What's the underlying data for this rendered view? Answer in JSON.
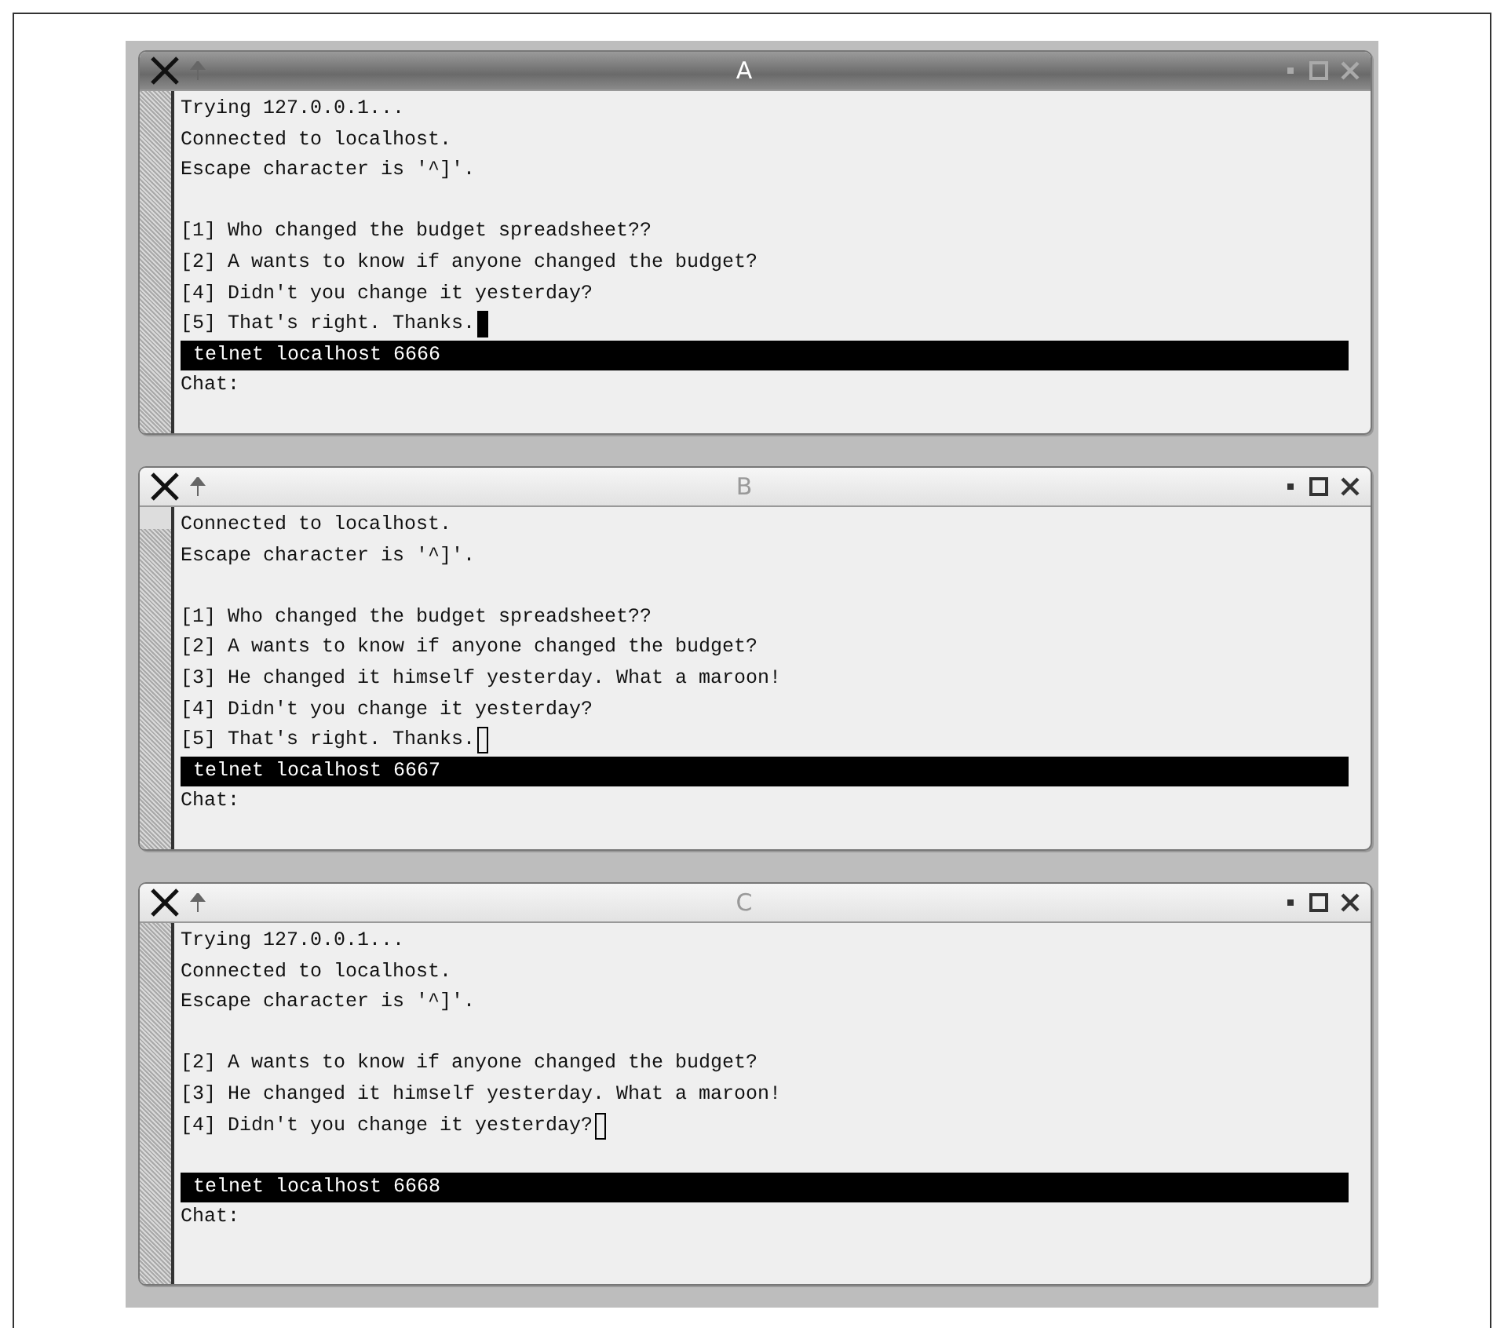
{
  "windows": [
    {
      "title": "A",
      "focused": true,
      "lines": [
        {
          "kind": "text",
          "text": "Trying 127.0.0.1..."
        },
        {
          "kind": "text",
          "text": "Connected to localhost."
        },
        {
          "kind": "text",
          "text": "Escape character is '^]'."
        },
        {
          "kind": "blank"
        },
        {
          "kind": "text",
          "text": "[1] Who changed the budget spreadsheet??"
        },
        {
          "kind": "text",
          "text": "[2] A wants to know if anyone changed the budget?"
        },
        {
          "kind": "text",
          "text": "[4] Didn't you change it yesterday?"
        },
        {
          "kind": "text",
          "text": "[5] That's right. Thanks."
        }
      ],
      "status": "telnet localhost 6666",
      "prompt": "Chat:"
    },
    {
      "title": "B",
      "focused": false,
      "lines": [
        {
          "kind": "text",
          "text": "Connected to localhost."
        },
        {
          "kind": "text",
          "text": "Escape character is '^]'."
        },
        {
          "kind": "blank"
        },
        {
          "kind": "text",
          "text": "[1] Who changed the budget spreadsheet??"
        },
        {
          "kind": "text",
          "text": "[2] A wants to know if anyone changed the budget?"
        },
        {
          "kind": "text",
          "text": "[3] He changed it himself yesterday. What a maroon!"
        },
        {
          "kind": "text",
          "text": "[4] Didn't you change it yesterday?"
        },
        {
          "kind": "text",
          "text": "[5] That's right. Thanks."
        }
      ],
      "status": "telnet localhost 6667",
      "prompt": "Chat:"
    },
    {
      "title": "C",
      "focused": false,
      "lines": [
        {
          "kind": "text",
          "text": "Trying 127.0.0.1..."
        },
        {
          "kind": "text",
          "text": "Connected to localhost."
        },
        {
          "kind": "text",
          "text": "Escape character is '^]'."
        },
        {
          "kind": "blank"
        },
        {
          "kind": "text",
          "text": "[2] A wants to know if anyone changed the budget?"
        },
        {
          "kind": "text",
          "text": "[3] He changed it himself yesterday. What a maroon!"
        },
        {
          "kind": "text",
          "text": "[4] Didn't you change it yesterday?"
        },
        {
          "kind": "blank"
        }
      ],
      "status": "telnet localhost 6668",
      "prompt": "Chat:"
    }
  ]
}
